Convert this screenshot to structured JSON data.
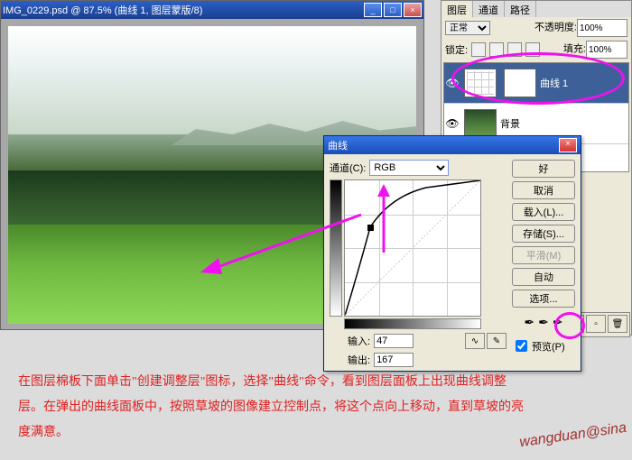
{
  "doc": {
    "title": "IMG_0229.psd @ 87.5% (曲线 1, 图层蒙版/8)"
  },
  "curves": {
    "title": "曲线",
    "channel_label": "通道(C):",
    "channel_value": "RGB",
    "input_label": "输入:",
    "input_value": "47",
    "output_label": "输出:",
    "output_value": "167",
    "buttons": {
      "ok": "好",
      "cancel": "取消",
      "load": "载入(L)...",
      "save": "存储(S)...",
      "smooth": "平滑(M)",
      "auto": "自动",
      "options": "选项..."
    },
    "preview_label": "预览(P)"
  },
  "layers": {
    "tab1": "图层",
    "tab2": "通道",
    "tab3": "路径",
    "blend": "正常",
    "opacity_label": "不透明度:",
    "opacity_value": "100%",
    "lock_label": "锁定:",
    "fill_label": "填充:",
    "fill_value": "100%",
    "layer1_name": "曲线 1",
    "layer2_name": "背景"
  },
  "instruction_text": "在图层棉板下面单击\"创建调整层\"图标，选择\"曲线\"命令，看到图层面板上出现曲线调整层。在弹出的曲线面板中，按照草坡的图像建立控制点，将这个点向上移动，直到草坡的亮度满意。",
  "watermark": "wangduan@sina"
}
